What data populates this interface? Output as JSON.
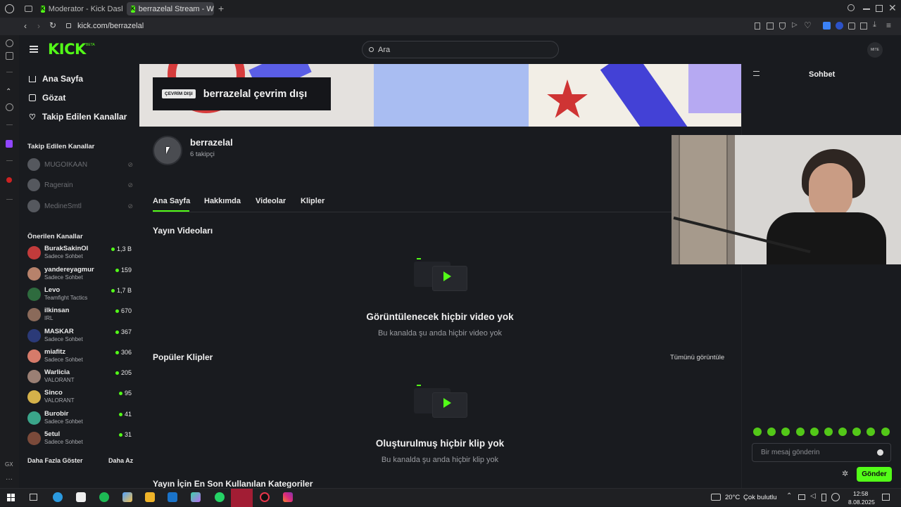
{
  "browser": {
    "tabs": [
      {
        "title": "Moderator - Kick Dashbo"
      },
      {
        "title": "berrazelal Stream - Watc"
      }
    ],
    "url": "kick.com/berrazelal"
  },
  "header": {
    "logo": "KICK",
    "logo_badge": "BETA",
    "search_placeholder": "Ara",
    "user_avatar_text": "MITE"
  },
  "sidebar": {
    "main_nav": [
      {
        "label": "Ana Sayfa",
        "icon": "home-icon"
      },
      {
        "label": "Gözat",
        "icon": "browse-icon"
      },
      {
        "label": "Takip Edilen Kanallar",
        "icon": "heart-icon"
      }
    ],
    "followed_title": "Takip Edilen Kanallar",
    "followed": [
      {
        "name": "MUGOIKAAN"
      },
      {
        "name": "Ragerain"
      },
      {
        "name": "MedineSmtl"
      }
    ],
    "recommended_title": "Önerilen Kanallar",
    "recommended": [
      {
        "name": "BurakSakinOl",
        "category": "Sadece Sohbet",
        "viewers": "1,3 B",
        "color": "#c23b3b"
      },
      {
        "name": "yandereyagmur",
        "category": "Sadece Sohbet",
        "viewers": "159",
        "color": "#b7826b"
      },
      {
        "name": "Levo",
        "category": "Teamfight Tactics",
        "viewers": "1,7 B",
        "color": "#2e6b3e"
      },
      {
        "name": "ilkinsan",
        "category": "IRL",
        "viewers": "670",
        "color": "#8a6a5a"
      },
      {
        "name": "MASKAR",
        "category": "Sadece Sohbet",
        "viewers": "367",
        "color": "#2b3a78"
      },
      {
        "name": "miafitz",
        "category": "Sadece Sohbet",
        "viewers": "306",
        "color": "#d67b6a"
      },
      {
        "name": "Warlicia",
        "category": "VALORANT",
        "viewers": "205",
        "color": "#9a7f74"
      },
      {
        "name": "Sinco",
        "category": "VALORANT",
        "viewers": "95",
        "color": "#d5b24a"
      },
      {
        "name": "Burobir",
        "category": "Sadece Sohbet",
        "viewers": "41",
        "color": "#3aa58a"
      },
      {
        "name": "5etul",
        "category": "Sadece Sohbet",
        "viewers": "31",
        "color": "#7b4a3a"
      }
    ],
    "show_more": "Daha Fazla Göster",
    "show_less": "Daha Az"
  },
  "channel": {
    "offline_badge": "ÇEVRİM DIŞI",
    "offline_text": "berrazelal çevrim dışı",
    "name": "berrazelal",
    "followers": "6 takipçi",
    "tabs": [
      "Ana Sayfa",
      "Hakkımda",
      "Videolar",
      "Klipler"
    ],
    "videos_title": "Yayın Videoları",
    "videos_empty_title": "Görüntülenecek hiçbir video yok",
    "videos_empty_sub": "Bu kanalda şu anda hiçbir video yok",
    "clips_title": "Popüler Klipler",
    "clips_view_all": "Tümünü görüntüle",
    "clips_empty_title": "Oluşturulmuş hiçbir klip yok",
    "clips_empty_sub": "Bu kanalda şu anda hiçbir klip yok",
    "categories_title": "Yayın İçin En Son Kullanılan Kategoriler"
  },
  "chat": {
    "title": "Sohbet",
    "input_placeholder": "Bir mesaj gönderin",
    "send_label": "Gönder"
  },
  "taskbar": {
    "weather_temp": "20°C",
    "weather_desc": "Çok bulutlu",
    "time": "12:58",
    "date": "8.08.2025"
  },
  "colors": {
    "brand": "#53fc18",
    "background": "#191b1f"
  }
}
